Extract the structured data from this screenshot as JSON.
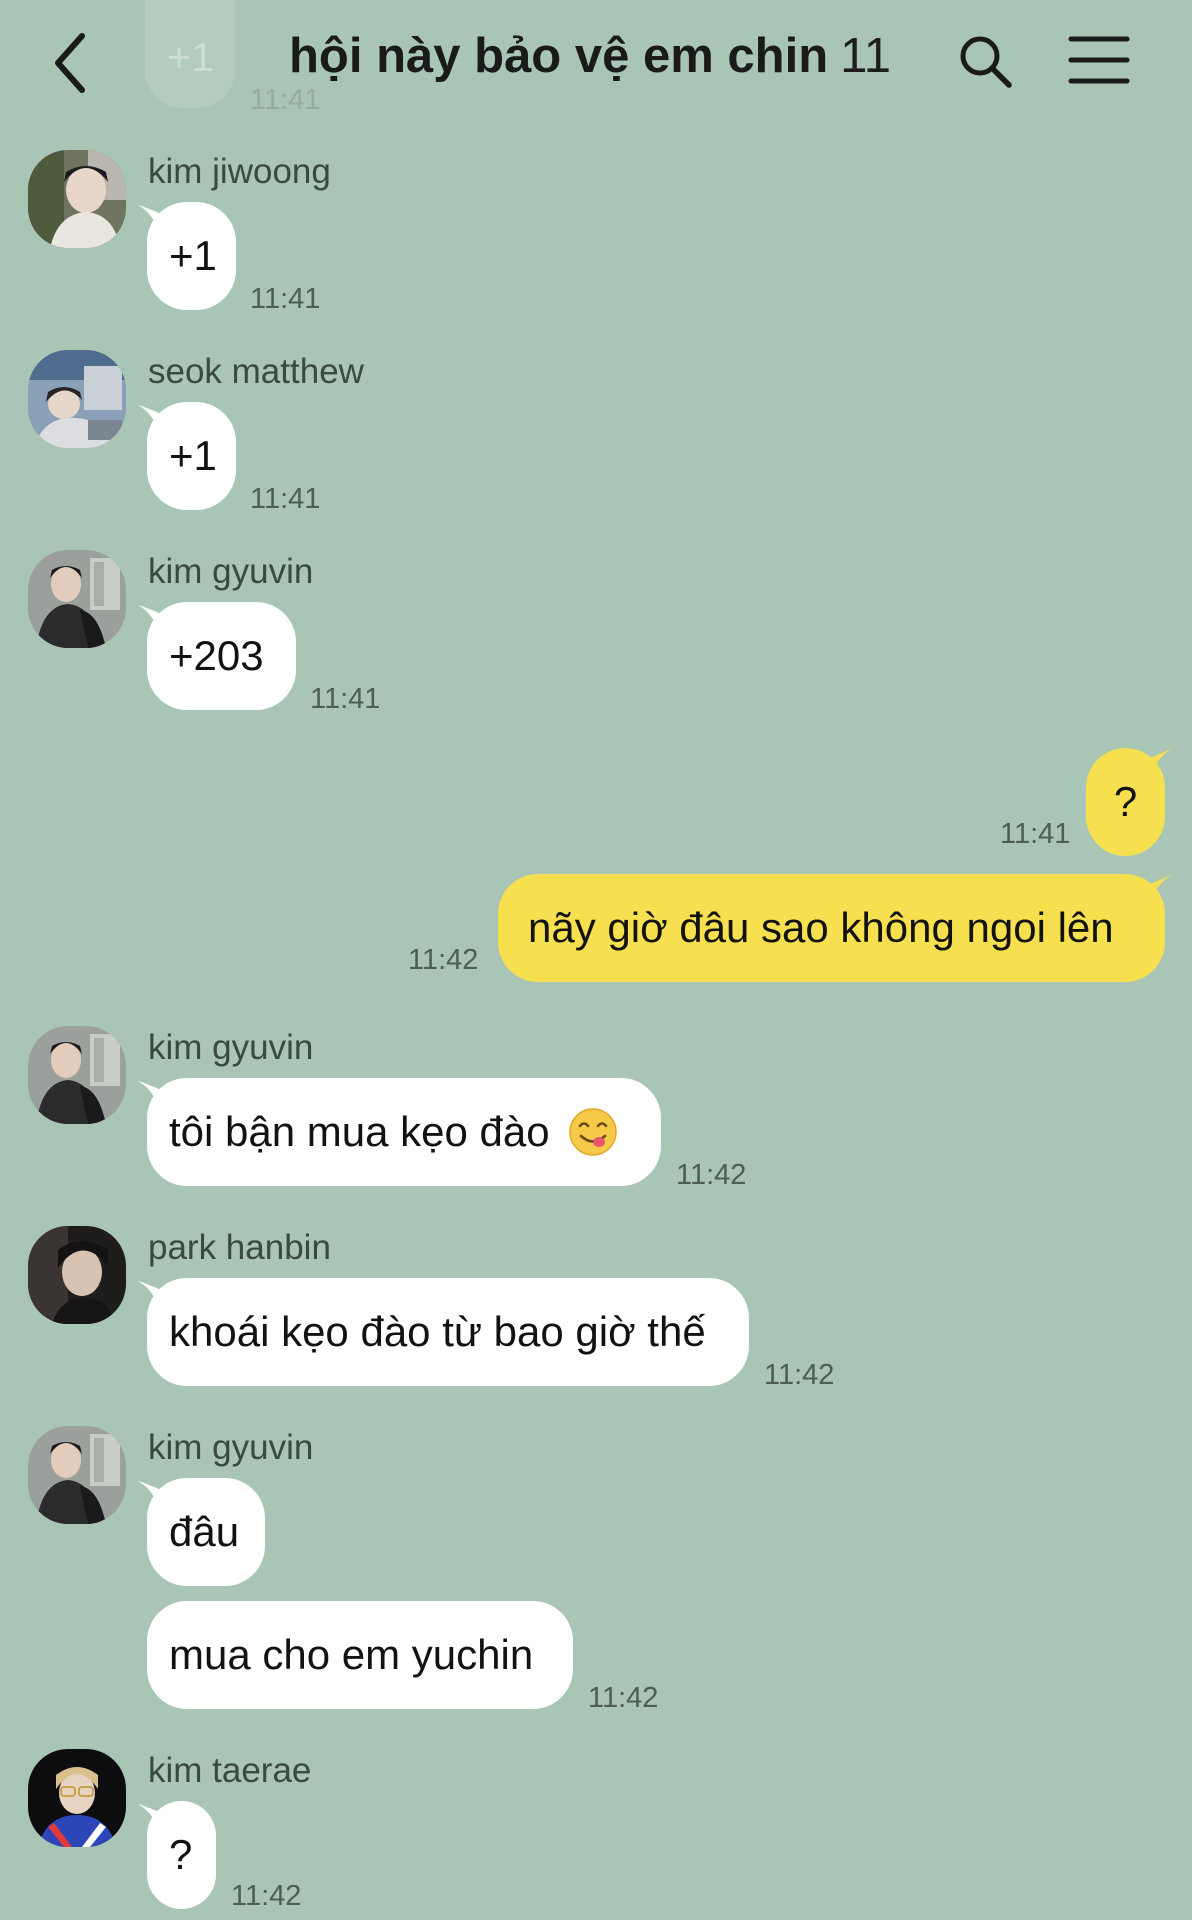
{
  "header": {
    "title": "hội này bảo vệ em chin",
    "member_count": "11"
  },
  "scrolled_top": {
    "text": "+1",
    "time": "11:41"
  },
  "messages": [
    {
      "sender": "kim jiwoong",
      "text": "+1",
      "time": "11:41"
    },
    {
      "sender": "seok matthew",
      "text": "+1",
      "time": "11:41"
    },
    {
      "sender": "kim gyuvin",
      "text": "+203",
      "time": "11:41"
    },
    {
      "sender": "me",
      "text": "?",
      "time": "11:41"
    },
    {
      "sender": "me",
      "text": "nãy giờ đâu sao không ngoi lên",
      "time": "11:42"
    },
    {
      "sender": "kim gyuvin",
      "text": "tôi bận mua kẹo đào",
      "time": "11:42",
      "emoji": "yum-face-emoji"
    },
    {
      "sender": "park hanbin",
      "text": "khoái kẹo đào từ bao giờ thế",
      "time": "11:42"
    },
    {
      "sender": "kim gyuvin",
      "text": "đâu"
    },
    {
      "sender": "kim gyuvin",
      "text": "mua cho em yuchin",
      "time": "11:42"
    },
    {
      "sender": "kim taerae",
      "text": "?",
      "time": "11:42"
    }
  ],
  "colors": {
    "background": "#a8c5b6",
    "incoming_bubble": "#ffffff",
    "outgoing_bubble": "#f6e04f"
  }
}
